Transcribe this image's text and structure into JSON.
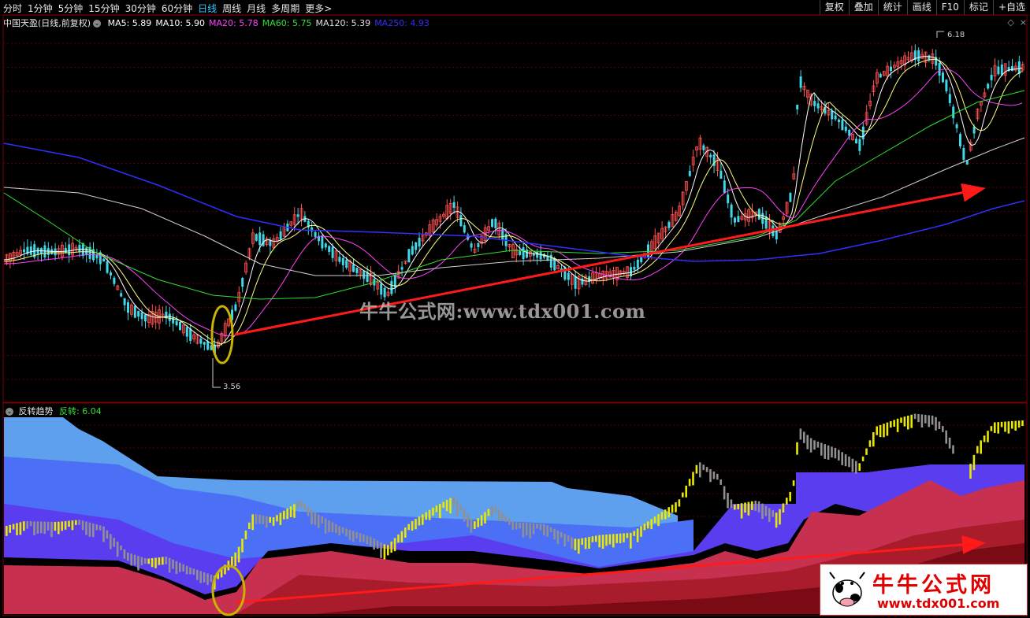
{
  "toolbar": {
    "periods": [
      "分时",
      "1分钟",
      "5分钟",
      "15分钟",
      "30分钟",
      "60分钟",
      "日线",
      "周线",
      "月线",
      "多周期",
      "更多>"
    ],
    "active_index": 6,
    "right_buttons": [
      "复权",
      "叠加",
      "统计",
      "画线",
      "F10",
      "标记",
      "+自选"
    ]
  },
  "main_chart": {
    "title": "中国天盈(日线,前复权)",
    "ma": [
      {
        "label": "MA5: 5.89",
        "color": "#ffffff"
      },
      {
        "label": "MA10: 5.90",
        "color": "#ffffff"
      },
      {
        "label": "MA20: 5.78",
        "color": "#ff40ff"
      },
      {
        "label": "MA60: 5.75",
        "color": "#30e030"
      },
      {
        "label": "MA120: 5.39",
        "color": "#e0e0e0"
      },
      {
        "label": "MA250: 4.93",
        "color": "#2f2fff"
      }
    ],
    "high_label": "6.18",
    "low_label": "3.56"
  },
  "indicator": {
    "name": "反转趋势",
    "value_label": "反转: 6.04",
    "value_color": "#30e030"
  },
  "watermark": "牛牛公式网:www.tdx001.com",
  "logo": {
    "title": "牛牛公式网",
    "url": "www.tdx001.com"
  },
  "colors": {
    "up": "#ff5050",
    "down": "#40d8e8",
    "arrow": "#ff1a1a",
    "highlight": "#c8b400"
  }
}
